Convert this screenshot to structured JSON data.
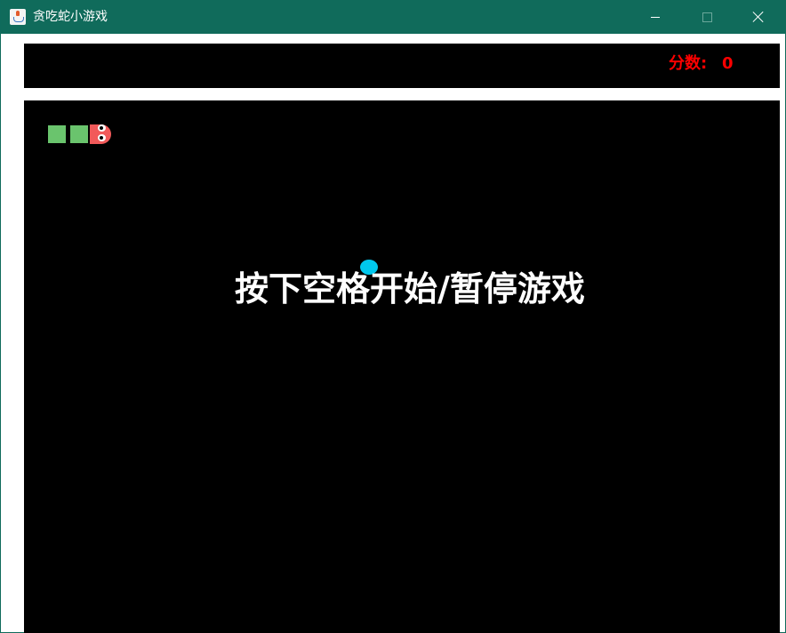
{
  "window": {
    "title": "贪吃蛇小游戏",
    "icon": "java-icon",
    "controls": [
      "minimize-icon",
      "maximize-icon",
      "close-icon"
    ]
  },
  "score": {
    "label": "分数:",
    "value": "0"
  },
  "board": {
    "message": "按下空格开始/暂停游戏",
    "snake": {
      "length": 3,
      "direction": "right",
      "body_color": "#6ac46d",
      "head_color": "#f25a5a"
    },
    "food_color": "#00c8ee"
  },
  "colors": {
    "titlebar": "#106b5b",
    "panel": "#000000",
    "score_text": "#ff0000",
    "message_text": "#ffffff"
  }
}
